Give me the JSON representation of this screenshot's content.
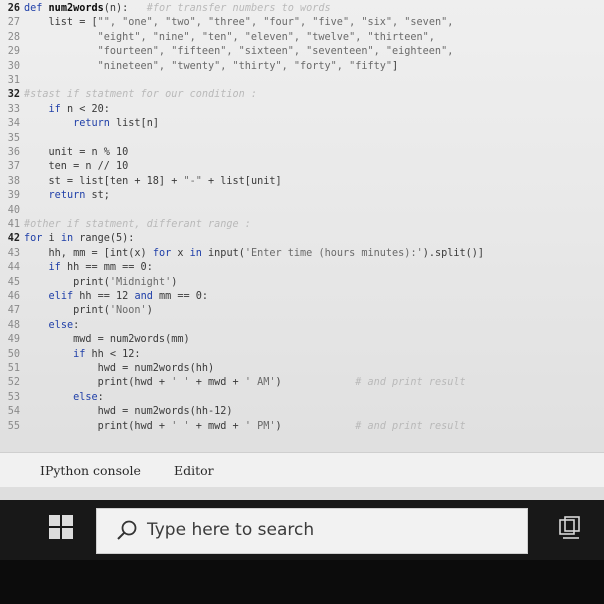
{
  "editor": {
    "lines": [
      {
        "n": "26",
        "bold": true,
        "parts": [
          [
            "kw",
            "def "
          ],
          [
            "fn",
            "num2words"
          ],
          [
            "t",
            "(n):   "
          ],
          [
            "cm",
            "#for transfer numbers to words"
          ]
        ]
      },
      {
        "n": "27",
        "parts": [
          [
            "t",
            "    list = ["
          ],
          [
            "str",
            "\"\", \"one\", \"two\", \"three\", \"four\", \"five\", \"six\", \"seven\","
          ]
        ]
      },
      {
        "n": "28",
        "parts": [
          [
            "str",
            "            \"eight\", \"nine\", \"ten\", \"eleven\", \"twelve\", \"thirteen\","
          ]
        ]
      },
      {
        "n": "29",
        "parts": [
          [
            "str",
            "            \"fourteen\", \"fifteen\", \"sixteen\", \"seventeen\", \"eighteen\","
          ]
        ]
      },
      {
        "n": "30",
        "parts": [
          [
            "str",
            "            \"nineteen\", \"twenty\", \"thirty\", \"forty\", \"fifty\""
          ],
          [
            "t",
            "]"
          ]
        ]
      },
      {
        "n": "31",
        "parts": []
      },
      {
        "n": "32",
        "bold": true,
        "parts": [
          [
            "cm",
            "#stast if statment for our condition :"
          ]
        ]
      },
      {
        "n": "33",
        "parts": [
          [
            "t",
            "    "
          ],
          [
            "kw",
            "if"
          ],
          [
            "t",
            " n < 20:"
          ]
        ]
      },
      {
        "n": "34",
        "parts": [
          [
            "t",
            "        "
          ],
          [
            "kw",
            "return"
          ],
          [
            "t",
            " list[n]"
          ]
        ]
      },
      {
        "n": "35",
        "parts": []
      },
      {
        "n": "36",
        "parts": [
          [
            "t",
            "    unit = n % 10"
          ]
        ]
      },
      {
        "n": "37",
        "parts": [
          [
            "t",
            "    ten = n // 10"
          ]
        ]
      },
      {
        "n": "38",
        "parts": [
          [
            "t",
            "    st = list[ten + 18] + "
          ],
          [
            "str",
            "\"-\""
          ],
          [
            "t",
            " + list[unit]"
          ]
        ]
      },
      {
        "n": "39",
        "parts": [
          [
            "t",
            "    "
          ],
          [
            "kw",
            "return"
          ],
          [
            "t",
            " st;"
          ]
        ]
      },
      {
        "n": "40",
        "parts": []
      },
      {
        "n": "41",
        "parts": [
          [
            "cm",
            "#other if statment, differant range :"
          ]
        ]
      },
      {
        "n": "42",
        "bold": true,
        "parts": [
          [
            "kw",
            "for"
          ],
          [
            "t",
            " i "
          ],
          [
            "kw",
            "in"
          ],
          [
            "t",
            " range(5):"
          ]
        ]
      },
      {
        "n": "43",
        "parts": [
          [
            "t",
            "    hh, mm = [int(x) "
          ],
          [
            "kw",
            "for"
          ],
          [
            "t",
            " x "
          ],
          [
            "kw",
            "in"
          ],
          [
            "t",
            " input("
          ],
          [
            "str",
            "'Enter time (hours minutes):'"
          ],
          [
            "t",
            ").split()]"
          ]
        ]
      },
      {
        "n": "44",
        "parts": [
          [
            "t",
            "    "
          ],
          [
            "kw",
            "if"
          ],
          [
            "t",
            " hh == mm == 0:"
          ]
        ]
      },
      {
        "n": "45",
        "parts": [
          [
            "t",
            "        print("
          ],
          [
            "str",
            "'Midnight'"
          ],
          [
            "t",
            ")"
          ]
        ]
      },
      {
        "n": "46",
        "parts": [
          [
            "t",
            "    "
          ],
          [
            "kw",
            "elif"
          ],
          [
            "t",
            " hh == 12 "
          ],
          [
            "kw",
            "and"
          ],
          [
            "t",
            " mm == 0:"
          ]
        ]
      },
      {
        "n": "47",
        "parts": [
          [
            "t",
            "        print("
          ],
          [
            "str",
            "'Noon'"
          ],
          [
            "t",
            ")"
          ]
        ]
      },
      {
        "n": "48",
        "parts": [
          [
            "t",
            "    "
          ],
          [
            "kw",
            "else"
          ],
          [
            "t",
            ":"
          ]
        ]
      },
      {
        "n": "49",
        "parts": [
          [
            "t",
            "        mwd = num2words(mm)"
          ]
        ]
      },
      {
        "n": "50",
        "parts": [
          [
            "t",
            "        "
          ],
          [
            "kw",
            "if"
          ],
          [
            "t",
            " hh < 12:"
          ]
        ]
      },
      {
        "n": "51",
        "parts": [
          [
            "t",
            "            hwd = num2words(hh)"
          ]
        ]
      },
      {
        "n": "52",
        "parts": [
          [
            "t",
            "            print(hwd + "
          ],
          [
            "str",
            "' '"
          ],
          [
            "t",
            " + mwd + "
          ],
          [
            "str",
            "' AM'"
          ],
          [
            "t",
            ")            "
          ],
          [
            "cm",
            "# and print result"
          ]
        ]
      },
      {
        "n": "53",
        "parts": [
          [
            "t",
            "        "
          ],
          [
            "kw",
            "else"
          ],
          [
            "t",
            ":"
          ]
        ]
      },
      {
        "n": "54",
        "parts": [
          [
            "t",
            "            hwd = num2words(hh-12)"
          ]
        ]
      },
      {
        "n": "55",
        "parts": [
          [
            "t",
            "            print(hwd + "
          ],
          [
            "str",
            "' '"
          ],
          [
            "t",
            " + mwd + "
          ],
          [
            "str",
            "' PM'"
          ],
          [
            "t",
            ")            "
          ],
          [
            "cm",
            "# and print result"
          ]
        ]
      }
    ]
  },
  "panes": {
    "tabs": [
      {
        "label": "IPython console"
      },
      {
        "label": "Editor"
      }
    ]
  },
  "taskbar": {
    "search_placeholder": "Type here to search",
    "start_icon": "windows-logo-icon",
    "search_icon": "search-icon",
    "taskview_icon": "task-view-icon"
  },
  "colors": {
    "keyword": "#1f3fa8",
    "comment": "#b9b9b9",
    "taskbar": "#181818",
    "editor_bg": "#ececec"
  }
}
